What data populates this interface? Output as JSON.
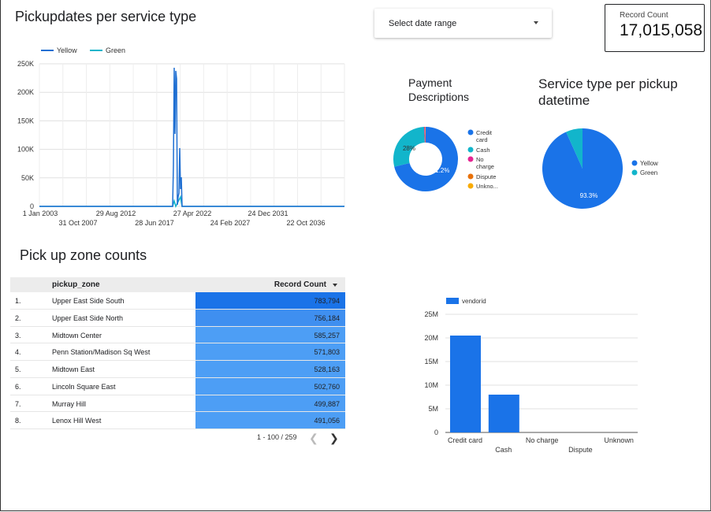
{
  "line_chart": {
    "title": "Pickupdates per service type",
    "legend": [
      {
        "name": "Yellow",
        "color": "#1f6fd2"
      },
      {
        "name": "Green",
        "color": "#12b5cb"
      }
    ],
    "y_ticks": [
      "0",
      "50K",
      "100K",
      "150K",
      "200K",
      "250K"
    ],
    "x_ticks_top": [
      "1 Jan 2003",
      "29 Aug 2012",
      "27 Apr 2022",
      "24 Dec 2031"
    ],
    "x_ticks_bottom": [
      "31 Oct 2007",
      "28 Jun 2017",
      "24 Feb 2027",
      "22 Oct 2036"
    ]
  },
  "date_range": {
    "label": "Select date range"
  },
  "scorecard": {
    "label": "Record Count",
    "value": "17,015,058"
  },
  "payment_pie": {
    "title": "Payment Descriptions",
    "slice_labels": {
      "credit": "71.2%",
      "cash": "28%"
    },
    "legend": [
      {
        "name": "Credit card",
        "color": "#1a73e8"
      },
      {
        "name": "Cash",
        "color": "#12b5cb"
      },
      {
        "name": "No charge",
        "color": "#e52592"
      },
      {
        "name": "Dispute",
        "color": "#e8710a"
      },
      {
        "name": "Unkno...",
        "color": "#f9ab00"
      }
    ]
  },
  "service_pie": {
    "title": "Service type per pickup datetime",
    "slice_label": "93.3%",
    "legend": [
      {
        "name": "Yellow",
        "color": "#1a73e8"
      },
      {
        "name": "Green",
        "color": "#12b5cb"
      }
    ]
  },
  "zone_table": {
    "title": "Pick up zone counts",
    "col_zone": "pickup_zone",
    "col_count": "Record Count",
    "rows": [
      {
        "idx": "1.",
        "zone": "Upper East Side South",
        "count": "783,794"
      },
      {
        "idx": "2.",
        "zone": "Upper East Side North",
        "count": "756,184"
      },
      {
        "idx": "3.",
        "zone": "Midtown Center",
        "count": "585,257"
      },
      {
        "idx": "4.",
        "zone": "Penn Station/Madison Sq West",
        "count": "571,803"
      },
      {
        "idx": "5.",
        "zone": "Midtown East",
        "count": "528,163"
      },
      {
        "idx": "6.",
        "zone": "Lincoln Square East",
        "count": "502,760"
      },
      {
        "idx": "7.",
        "zone": "Murray Hill",
        "count": "499,887"
      },
      {
        "idx": "8.",
        "zone": "Lenox Hill West",
        "count": "491,056"
      }
    ],
    "pager": "1 - 100 / 259"
  },
  "chart_data": [
    {
      "type": "bar",
      "categories": [
        "Credit card",
        "Cash",
        "No charge",
        "Dispute",
        "Unknown"
      ],
      "series": [
        {
          "name": "vendorid",
          "values": [
            20500000,
            8000000,
            0,
            0,
            0
          ]
        }
      ],
      "y_ticks": [
        "0",
        "5M",
        "10M",
        "15M",
        "20M",
        "25M"
      ],
      "ylim": [
        0,
        25000000
      ],
      "color": "#1a73e8"
    },
    {
      "type": "pie",
      "title": "Payment Descriptions",
      "categories": [
        "Credit card",
        "Cash",
        "No charge",
        "Dispute",
        "Unkno..."
      ],
      "values": [
        71.2,
        28,
        0.5,
        0.2,
        0.1
      ]
    },
    {
      "type": "pie",
      "title": "Service type per pickup datetime",
      "categories": [
        "Yellow",
        "Green"
      ],
      "values": [
        93.3,
        6.7
      ]
    }
  ]
}
